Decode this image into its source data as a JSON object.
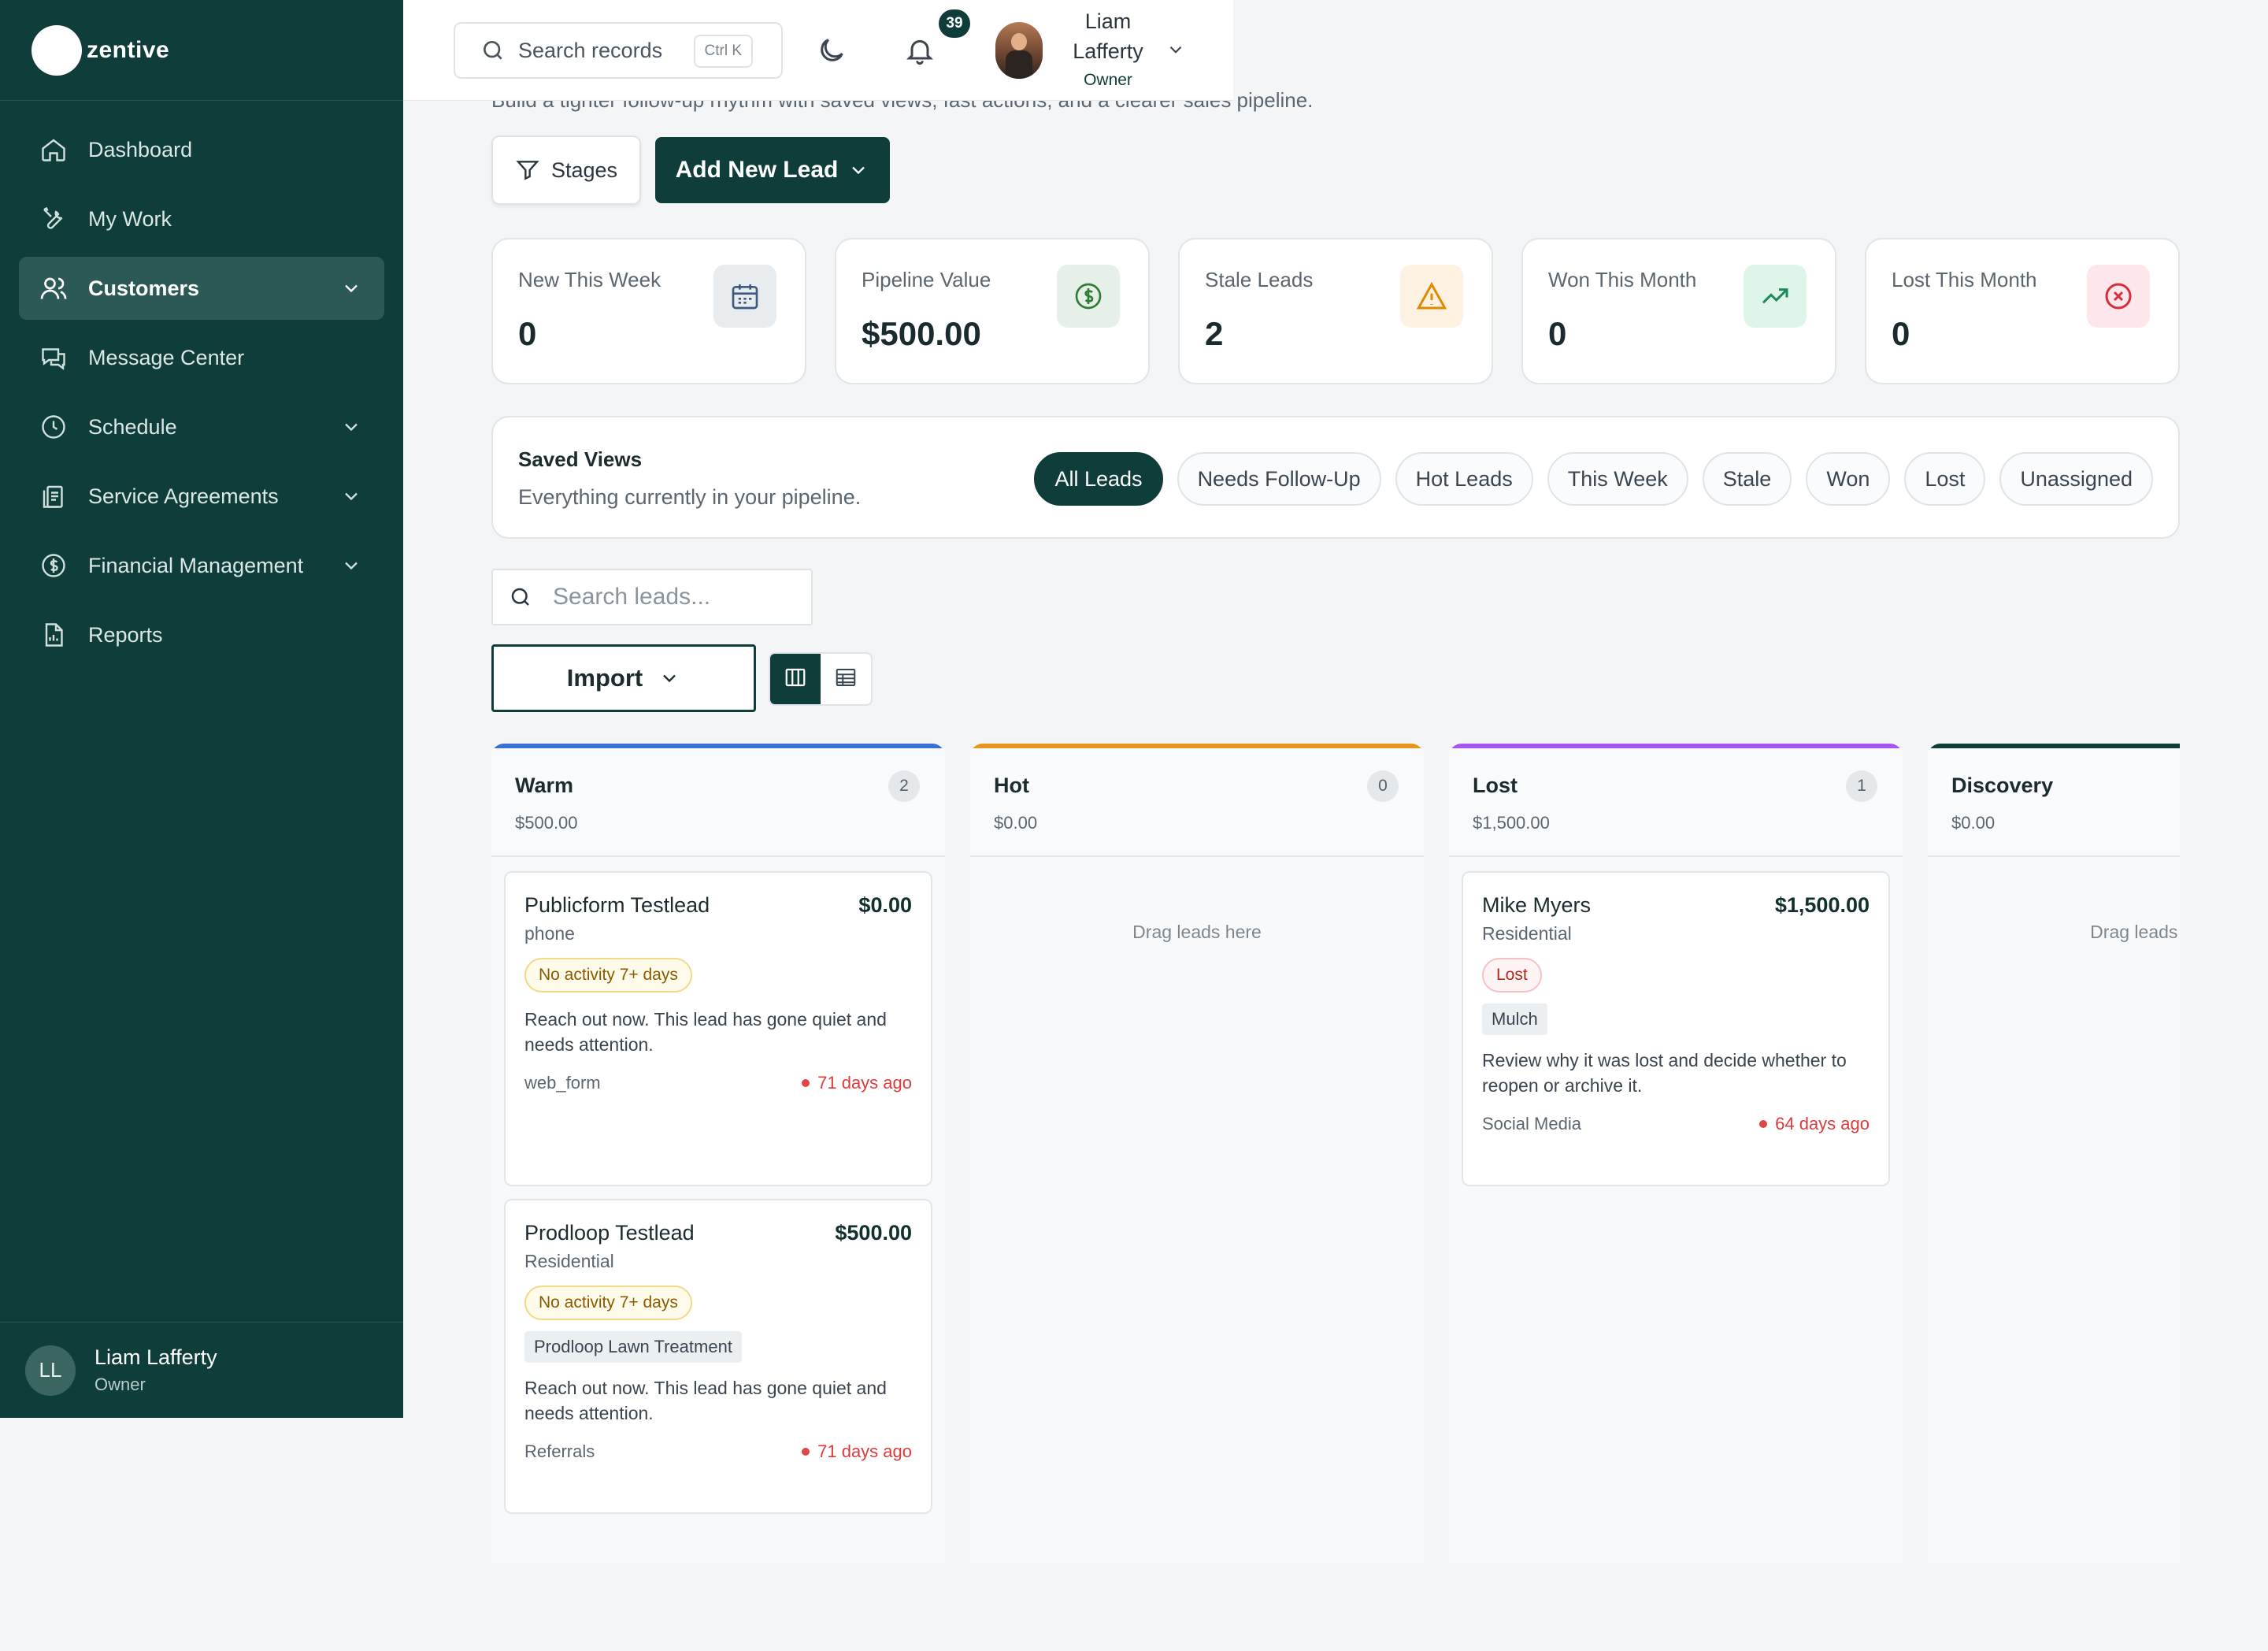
{
  "brand": {
    "name": "zentive"
  },
  "sidebar": {
    "items": [
      {
        "label": "Dashboard",
        "icon": "home-icon"
      },
      {
        "label": "My Work",
        "icon": "tools-icon"
      },
      {
        "label": "Customers",
        "icon": "users-icon",
        "active": true
      },
      {
        "label": "Message Center",
        "icon": "chat-icon"
      },
      {
        "label": "Schedule",
        "icon": "clock-icon"
      },
      {
        "label": "Service Agreements",
        "icon": "clipboard-icon"
      },
      {
        "label": "Financial Management",
        "icon": "dollar-icon"
      },
      {
        "label": "Reports",
        "icon": "report-icon"
      }
    ],
    "user": {
      "initials": "LL",
      "name": "Liam Lafferty",
      "role": "Owner"
    }
  },
  "topbar": {
    "search_placeholder": "Search records",
    "shortcut": "Ctrl K",
    "notification_count": "39",
    "user_name": "Liam Lafferty",
    "user_role": "Owner"
  },
  "page": {
    "subtitle": "Build a tighter follow-up rhythm with saved views, fast actions, and a clearer sales pipeline.",
    "stages_label": "Stages",
    "add_lead_label": "Add New Lead"
  },
  "stats": [
    {
      "label": "New This Week",
      "value": "0",
      "icon": "calendar-icon",
      "color": "#3d5a80"
    },
    {
      "label": "Pipeline Value",
      "value": "$500.00",
      "icon": "dollar-circle-icon",
      "color": "#2e7d32"
    },
    {
      "label": "Stale Leads",
      "value": "2",
      "icon": "warning-icon",
      "color": "#e08a00"
    },
    {
      "label": "Won This Month",
      "value": "0",
      "icon": "trending-up-icon",
      "color": "#1b8a5a"
    },
    {
      "label": "Lost This Month",
      "value": "0",
      "icon": "x-circle-icon",
      "color": "#d32f3f"
    }
  ],
  "saved_views": {
    "title": "Saved Views",
    "description": "Everything currently in your pipeline.",
    "tabs": [
      "All Leads",
      "Needs Follow-Up",
      "Hot Leads",
      "This Week",
      "Stale",
      "Won",
      "Lost",
      "Unassigned"
    ],
    "active_tab": "All Leads"
  },
  "lead_search": {
    "placeholder": "Search leads..."
  },
  "import_label": "Import",
  "columns": [
    {
      "title": "Warm",
      "total": "$500.00",
      "count": "2",
      "accent": "#3a6fd8",
      "cards": [
        {
          "name": "Publicform Testlead",
          "value": "$0.00",
          "sub": "phone",
          "badge": "No activity 7+ days",
          "tag": "",
          "desc": "Reach out now. This lead has gone quiet and needs attention.",
          "source": "web_form",
          "age": "71 days ago"
        },
        {
          "name": "Prodloop Testlead",
          "value": "$500.00",
          "sub": "Residential",
          "badge": "No activity 7+ days",
          "tag": "Prodloop Lawn Treatment",
          "desc": "Reach out now. This lead has gone quiet and needs attention.",
          "source": "Referrals",
          "age": "71 days ago"
        }
      ]
    },
    {
      "title": "Hot",
      "total": "$0.00",
      "count": "0",
      "accent": "#e8951c",
      "empty_text": "Drag leads here",
      "cards": []
    },
    {
      "title": "Lost",
      "total": "$1,500.00",
      "count": "1",
      "accent": "#a855f7",
      "cards": [
        {
          "name": "Mike Myers",
          "value": "$1,500.00",
          "sub": "Residential",
          "badge": "Lost",
          "tag": "Mulch",
          "desc": "Review why it was lost and decide whether to reopen or archive it.",
          "source": "Social Media",
          "age": "64 days ago"
        }
      ]
    },
    {
      "title": "Discovery",
      "total": "$0.00",
      "count": "",
      "accent": "#0f3d3a",
      "empty_text": "Drag leads here",
      "cards": []
    }
  ]
}
